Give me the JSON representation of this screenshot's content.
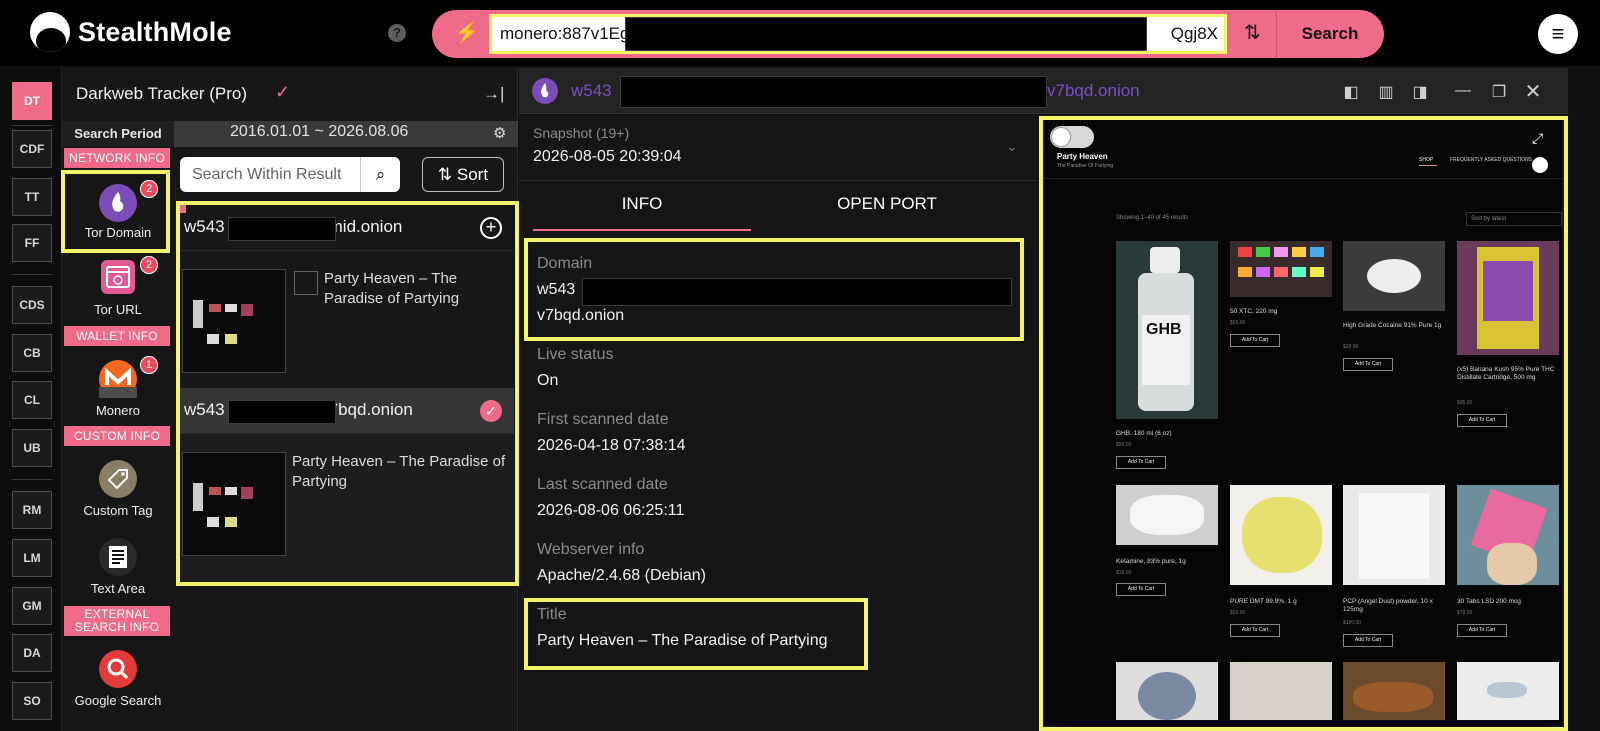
{
  "app": {
    "name": "StealthMole",
    "help": "?"
  },
  "search": {
    "query_start": "monero:887v1Eg",
    "query_end": "Qgj8X",
    "button": "Search"
  },
  "rail": [
    "DT",
    "CDF",
    "TT",
    "FF",
    "CDS",
    "CB",
    "CL",
    "UB",
    "RM",
    "LM",
    "GM",
    "DA",
    "SO"
  ],
  "panel": {
    "title": "Darkweb Tracker (Pro)",
    "period_label": "Search Period",
    "period": "2016.01.01 ~ 2026.08.06",
    "filter_placeholder": "Search Within Result",
    "sort": "Sort"
  },
  "categories": {
    "network_head": "NETWORK INFO",
    "tor_domain": {
      "label": "Tor Domain",
      "badge": "2"
    },
    "tor_url": {
      "label": "Tor URL",
      "badge": "2"
    },
    "wallet_head": "WALLET INFO",
    "monero": {
      "label": "Monero",
      "badge": "1"
    },
    "custom_head": "CUSTOM INFO",
    "custom_tag": {
      "label": "Custom Tag"
    },
    "text_area": {
      "label": "Text Area"
    },
    "external_head": "EXTERNAL SEARCH INFO",
    "google": {
      "label": "Google Search"
    }
  },
  "results": [
    {
      "domain_start": "w543",
      "domain_end": "mid.onion",
      "title": "Party Heaven – The Paradise of Partying",
      "action": "+"
    },
    {
      "domain_start": "w543",
      "domain_end": "7bqd.onion",
      "title": "Party Heaven – The Paradise of Partying",
      "action": "✓"
    }
  ],
  "detail": {
    "title_start": "w543",
    "title_end": "v7bqd.onion",
    "snapshot_label": "Snapshot (19+)",
    "snapshot_date": "2026-08-05 20:39:04",
    "tabs": [
      "INFO",
      "OPEN PORT"
    ],
    "fields": {
      "domain_label": "Domain",
      "domain_start": "w543",
      "domain_end": "v7bqd.onion",
      "live_label": "Live status",
      "live_value": "On",
      "first_label": "First scanned date",
      "first_value": "2026-04-18 07:38:14",
      "last_label": "Last scanned date",
      "last_value": "2026-08-06 06:25:11",
      "web_label": "Webserver info",
      "web_value": "Apache/2.4.68 (Debian)",
      "title_label": "Title",
      "title_value": "Party Heaven – The Paradise of Partying"
    }
  },
  "site": {
    "title": "Party Heaven",
    "subtitle": "The Paradise Of Partying",
    "nav": [
      "SHOP",
      "FREQUENTLY ASKED QUESTIONS"
    ],
    "showing": "Showing 1–40 of 45 results",
    "sort": "Sort by latest",
    "cart": "Add To Cart",
    "products": [
      {
        "name": "GHB, 180 ml (6 oz)",
        "price": "$90.00"
      },
      {
        "name": "50 XTC, 220 mg",
        "price": "$55.00"
      },
      {
        "name": "High Grade Cocaine 91% Pure 1g",
        "price": "$29.00"
      },
      {
        "name": "(x5) Banana Kush 95% Pure THC Distillate Cartridge, 500 mg",
        "price": "$95.00"
      },
      {
        "name": "Ketamine, 83% pure, 1g",
        "price": "$15.00"
      },
      {
        "name": "PURE DMT 99.9%, 1 g",
        "price": "$55.00"
      },
      {
        "name": "PCP (Angel Dust) powder, 10 x 125mg",
        "price": "$120.00"
      },
      {
        "name": "30 Tabs LSD 200 mcg",
        "price": "$79.00"
      }
    ]
  },
  "colors": {
    "accent": "#f06a8a",
    "highlight": "#f4f46a",
    "tor": "#7c4db8",
    "monero": "#f26822"
  }
}
